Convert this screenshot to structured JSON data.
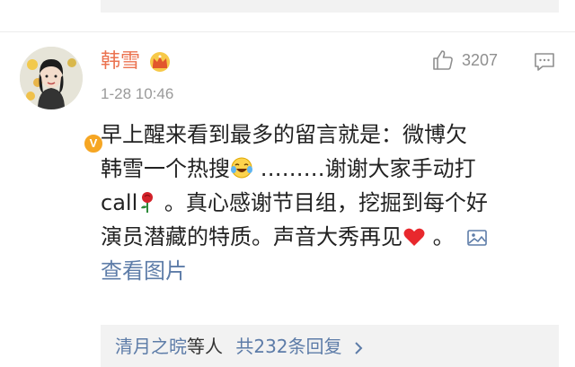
{
  "comment": {
    "user_name": "韩雪",
    "time": "1-28 10:46",
    "like_count": "3207",
    "verified_badge": "V",
    "content": {
      "line1": "早上醒来看到最多的留言就是：微博欠",
      "line2a": "韩雪一个热搜",
      "line2b": " ………谢谢大家手动打",
      "line3a": "call",
      "line3b": " 。真心感谢节目组，挖掘到每个好",
      "line4a": "演员潜藏的特质。声音大秀再见",
      "line4b": " 。",
      "view_image": "查看图片"
    },
    "icons": {
      "like": "thumbs-up-icon",
      "comment": "comment-icon",
      "vip": "crown-icon",
      "image": "image-icon",
      "laugh": "tears-of-joy-emoji",
      "rose": "rose-emoji",
      "heart": "red-heart-emoji"
    }
  },
  "replies": {
    "names": "清月之晥",
    "and_others": "等人",
    "total": "共232条回复"
  },
  "colors": {
    "name": "#eb7350",
    "link": "#5d7ca8",
    "meta": "#9a9a9a",
    "reply_bg": "#f2f2f2"
  }
}
